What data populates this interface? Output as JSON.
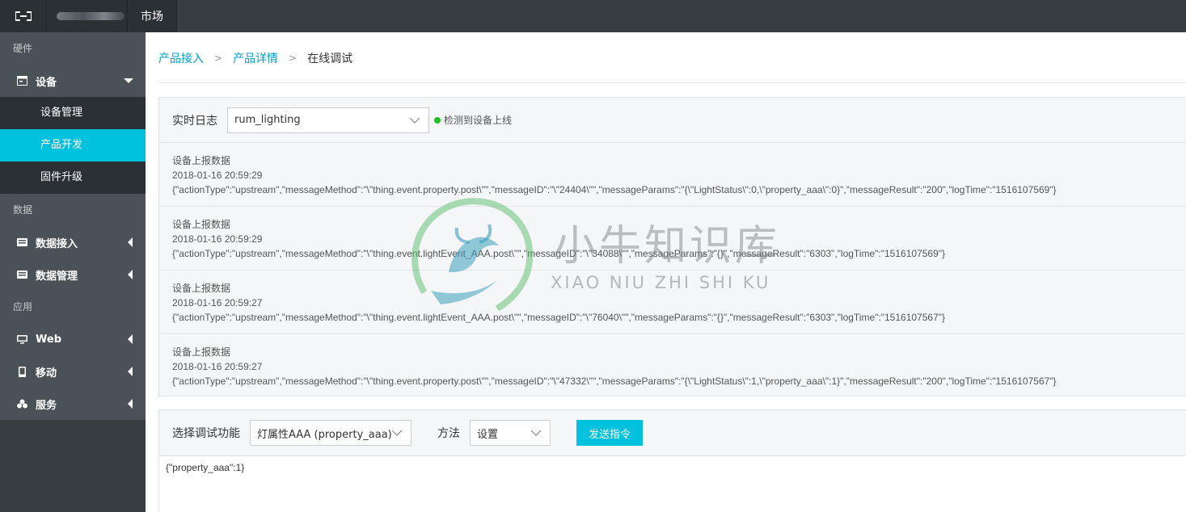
{
  "topbar": {
    "market": "市场"
  },
  "sidebar": {
    "sections": {
      "hardware": "硬件",
      "data": "数据",
      "app": "应用"
    },
    "device": {
      "label": "设备",
      "icon": "device-icon",
      "children": [
        "设备管理",
        "产品开发",
        "固件升级"
      ],
      "active_child": "产品开发"
    },
    "data_items": [
      {
        "label": "数据接入",
        "icon": "data-access-icon"
      },
      {
        "label": "数据管理",
        "icon": "data-manage-icon"
      }
    ],
    "app_items": [
      {
        "label": "Web",
        "icon": "monitor-icon"
      },
      {
        "label": "移动",
        "icon": "mobile-icon"
      },
      {
        "label": "服务",
        "icon": "services-icon"
      }
    ]
  },
  "breadcrumb": {
    "item1": "产品接入",
    "item2": "产品详情",
    "current": "在线调试"
  },
  "log": {
    "label": "实时日志",
    "device_select": "rum_lighting",
    "status": "检测到设备上线",
    "status_color": "#1dc11d",
    "entries": [
      {
        "title": "设备上报数据",
        "time": "2018-01-16 20:59:29",
        "json": "{\"actionType\":\"upstream\",\"messageMethod\":\"\\\"thing.event.property.post\\\"\",\"messageID\":\"\\\"24404\\\"\",\"messageParams\":\"{\\\"LightStatus\\\":0,\\\"property_aaa\\\":0}\",\"messageResult\":\"200\",\"logTime\":\"1516107569\"}"
      },
      {
        "title": "设备上报数据",
        "time": "2018-01-16 20:59:29",
        "json": "{\"actionType\":\"upstream\",\"messageMethod\":\"\\\"thing.event.lightEvent_AAA.post\\\"\",\"messageID\":\"\\\"34088\\\"\",\"messageParams\":\"{}\",\"messageResult\":\"6303\",\"logTime\":\"1516107569\"}"
      },
      {
        "title": "设备上报数据",
        "time": "2018-01-16 20:59:27",
        "json": "{\"actionType\":\"upstream\",\"messageMethod\":\"\\\"thing.event.lightEvent_AAA.post\\\"\",\"messageID\":\"\\\"76040\\\"\",\"messageParams\":\"{}\",\"messageResult\":\"6303\",\"logTime\":\"1516107567\"}"
      },
      {
        "title": "设备上报数据",
        "time": "2018-01-16 20:59:27",
        "json": "{\"actionType\":\"upstream\",\"messageMethod\":\"\\\"thing.event.property.post\\\"\",\"messageID\":\"\\\"47332\\\"\",\"messageParams\":\"{\\\"LightStatus\\\":1,\\\"property_aaa\\\":1}\",\"messageResult\":\"200\",\"logTime\":\"1516107567\"}"
      }
    ]
  },
  "debug": {
    "function_label": "选择调试功能",
    "function_value": "灯属性AAA (property_aaa)",
    "method_label": "方法",
    "method_value": "设置",
    "send_label": "发送指令",
    "payload": "{\"property_aaa\":1}"
  },
  "watermark": {
    "title": "小牛知识库",
    "subtitle": "XIAO NIU ZHI SHI KU"
  },
  "colors": {
    "accent": "#00c1de",
    "link": "#00a2ca",
    "sidebar": "#373d41"
  }
}
